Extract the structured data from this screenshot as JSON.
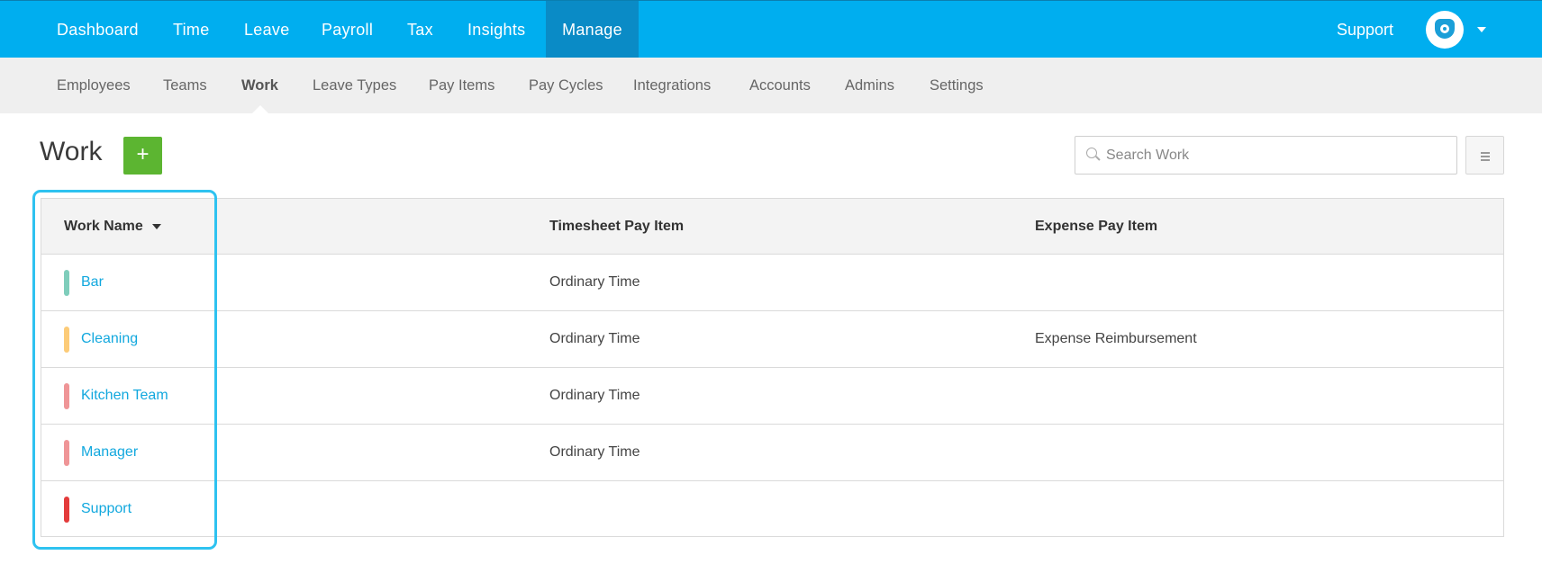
{
  "top_nav": {
    "items": [
      {
        "label": "Dashboard"
      },
      {
        "label": "Time"
      },
      {
        "label": "Leave"
      },
      {
        "label": "Payroll"
      },
      {
        "label": "Tax"
      },
      {
        "label": "Insights"
      },
      {
        "label": "Manage",
        "active": true
      }
    ],
    "support_label": "Support",
    "avatar_icon": "shield-logo-icon"
  },
  "sub_nav": {
    "items": [
      {
        "label": "Employees"
      },
      {
        "label": "Teams"
      },
      {
        "label": "Work",
        "active": true
      },
      {
        "label": "Leave Types"
      },
      {
        "label": "Pay Items"
      },
      {
        "label": "Pay Cycles"
      },
      {
        "label": "Integrations"
      },
      {
        "label": "Accounts"
      },
      {
        "label": "Admins"
      },
      {
        "label": "Settings"
      }
    ]
  },
  "page": {
    "title": "Work",
    "add_label": "+",
    "search_placeholder": "Search Work"
  },
  "table": {
    "columns": [
      "Work Name",
      "Timesheet Pay Item",
      "Expense Pay Item"
    ],
    "sorted_by": "Work Name",
    "rows": [
      {
        "name": "Bar",
        "color": "#7fcdbb",
        "timesheet": "Ordinary Time",
        "expense": ""
      },
      {
        "name": "Cleaning",
        "color": "#fccb78",
        "timesheet": "Ordinary Time",
        "expense": "Expense Reimbursement"
      },
      {
        "name": "Kitchen Team",
        "color": "#ef9597",
        "timesheet": "Ordinary Time",
        "expense": ""
      },
      {
        "name": "Manager",
        "color": "#ef9597",
        "timesheet": "Ordinary Time",
        "expense": ""
      },
      {
        "name": "Support",
        "color": "#e33b3b",
        "timesheet": "",
        "expense": ""
      }
    ]
  },
  "colors": {
    "brand": "#00aeef",
    "active_nav": "#0a8bc6",
    "add_button": "#5cb531",
    "link": "#12a8de",
    "highlight": "#2ec2f0"
  }
}
